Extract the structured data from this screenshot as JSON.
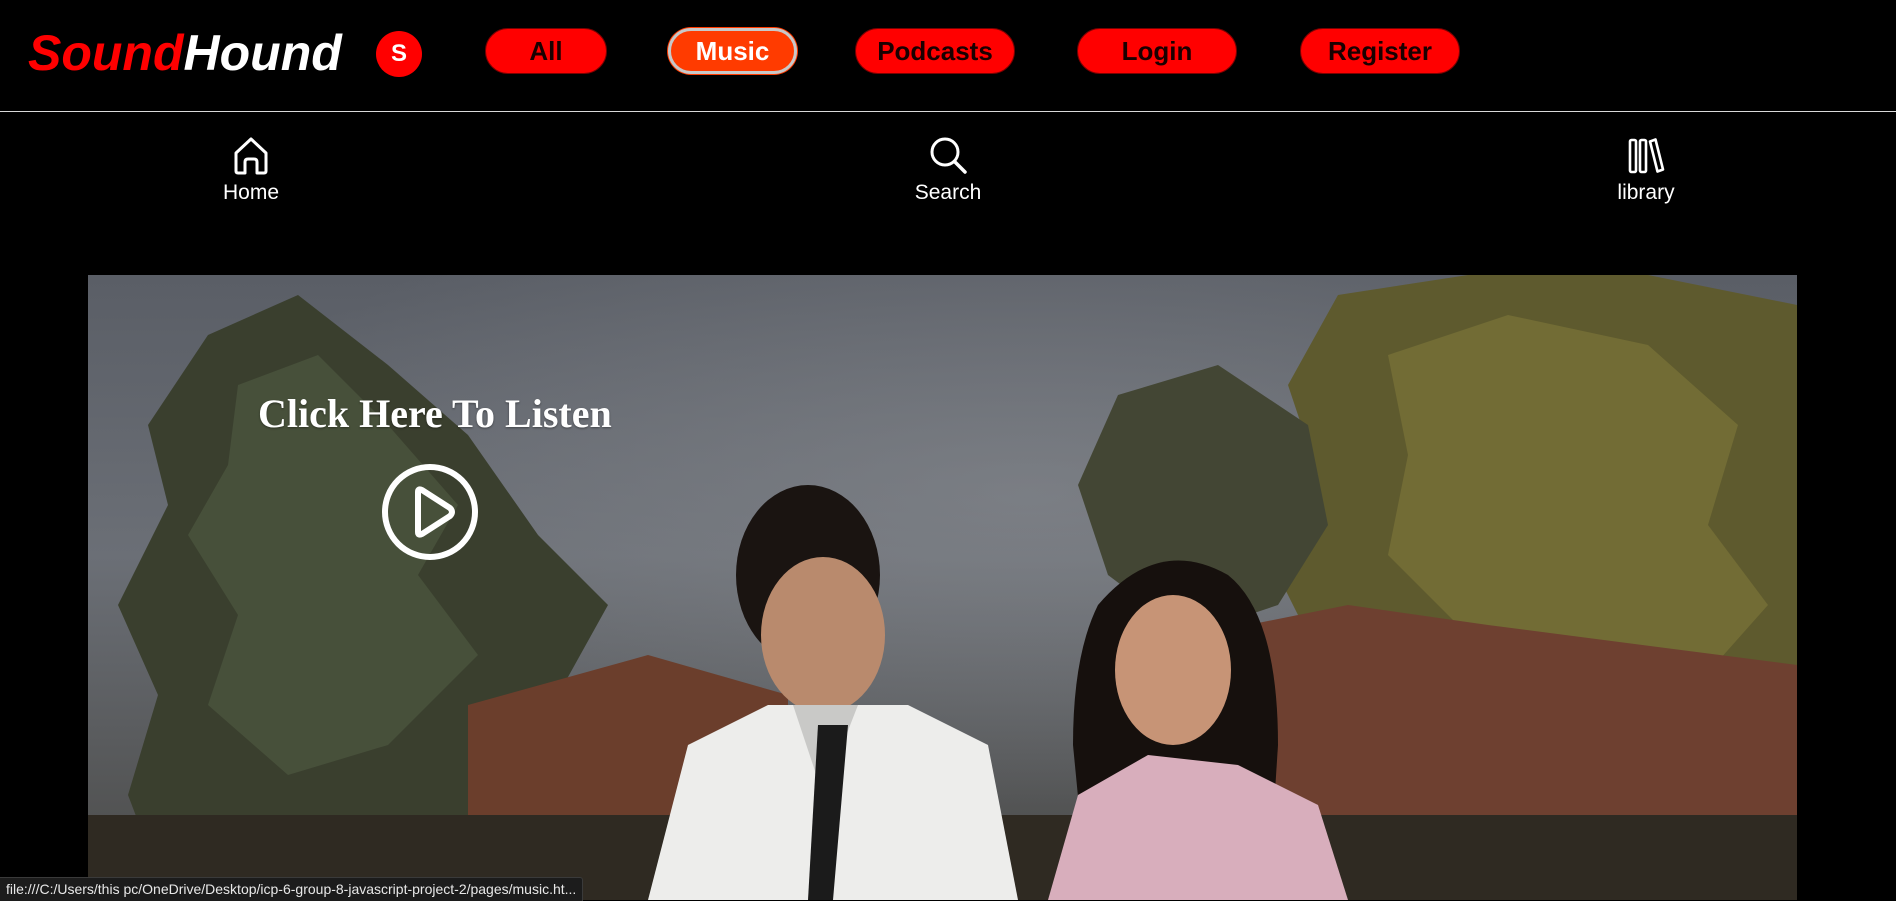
{
  "brand": {
    "logo_part1": "Sound",
    "logo_part2": "Hound",
    "logo_color_red": "#ff0000",
    "logo_color_white": "#ffffff"
  },
  "header": {
    "avatar_initial": "S",
    "tabs": [
      {
        "label": "All",
        "active": false
      },
      {
        "label": "Music",
        "active": true
      },
      {
        "label": "Podcasts",
        "active": false
      },
      {
        "label": "Login",
        "active": false
      },
      {
        "label": "Register",
        "active": false
      }
    ],
    "accent_color": "#ff0000",
    "active_tab_color": "#ff3b00"
  },
  "nav": {
    "items": [
      {
        "label": "Home",
        "icon": "home-icon"
      },
      {
        "label": "Search",
        "icon": "search-icon"
      },
      {
        "label": "library",
        "icon": "library-icon"
      }
    ]
  },
  "hero": {
    "title": "Click Here To Listen",
    "play_icon": "play-circle-icon"
  },
  "status_bar": {
    "url": "file:///C:/Users/this pc/OneDrive/Desktop/icp-6-group-8-javascript-project-2/pages/music.ht..."
  }
}
